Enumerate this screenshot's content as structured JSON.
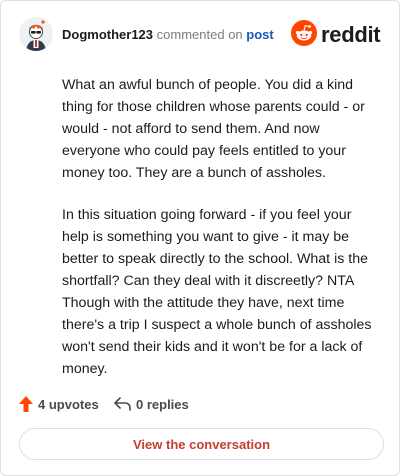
{
  "comment": {
    "username": "Dogmother123",
    "action_text": "commented on",
    "post_link": "post",
    "paragraphs": [
      "What an awful bunch of people. You did a kind thing for those children whose parents could - or would - not afford to send them. And now everyone who could pay feels entitled to your money too. They are a bunch of assholes.",
      "In this situation going forward - if you feel your help is something you want to give - it may be better to speak directly to the school. What is the shortfall? Can they deal with it discreetly? NTA Though with the attitude they have, next time there's a trip I suspect a whole bunch of assholes won't send their kids and it won't be for a lack of money."
    ]
  },
  "brand": {
    "wordmark": "reddit",
    "icon": "reddit-snoo-icon",
    "accent": "#ff4500"
  },
  "actions": {
    "upvotes_label": "4 upvotes",
    "upvote_icon": "upvote-arrow-icon",
    "replies_label": "0 replies",
    "reply_icon": "reply-arrow-icon"
  },
  "cta": {
    "label": "View the conversation",
    "color": "#c4402f"
  },
  "colors": {
    "link": "#1a57b6",
    "muted": "#7c7c7c",
    "text": "#1c1c1c"
  }
}
